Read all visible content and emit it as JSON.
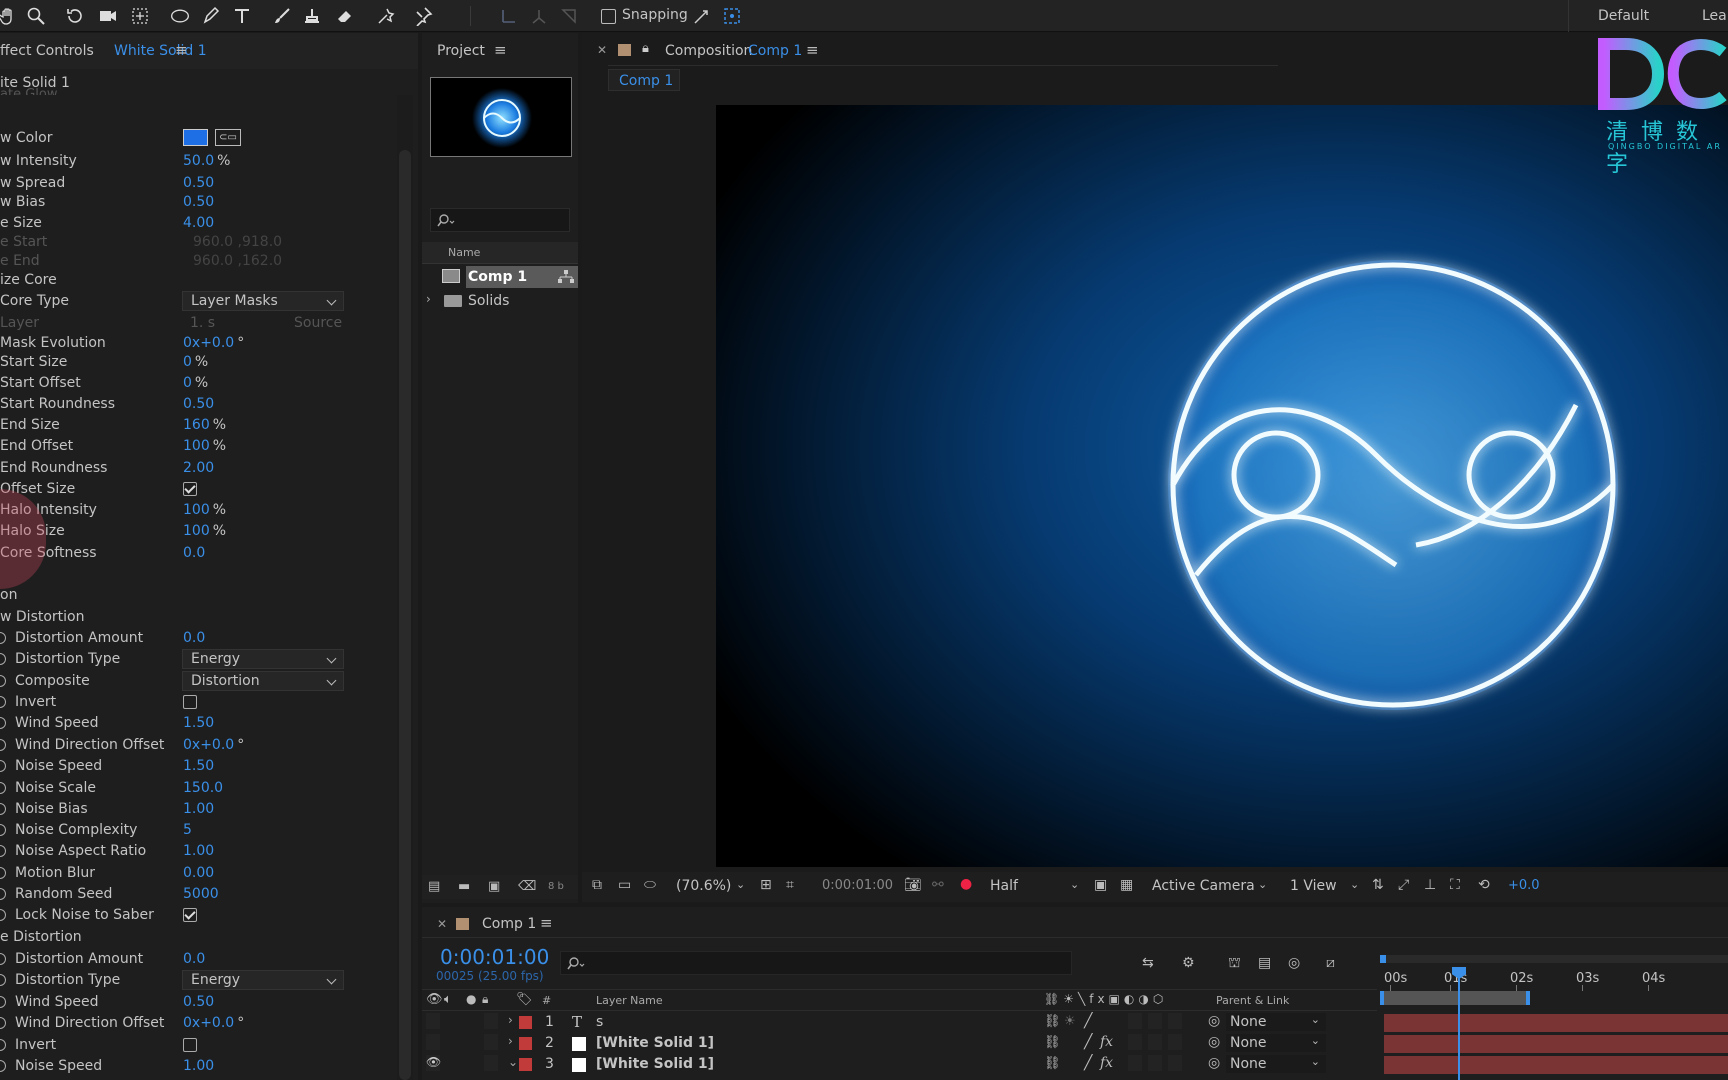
{
  "toolbar": {
    "snapping_label": "Snapping",
    "workspace_default": "Default",
    "workspace_learn": "Lear",
    "tools": [
      "hand-icon",
      "zoom-icon",
      "rotate-icon",
      "camera-icon",
      "pan-behind-icon",
      "ellipse-icon",
      "pen-icon",
      "type-icon",
      "brush-icon",
      "clone-stamp-icon",
      "eraser-icon",
      "roto-brush-icon",
      "puppet-pin-icon"
    ]
  },
  "effect_controls": {
    "tab_prefix": "ffect Controls",
    "tab_layer": "White Solid 1",
    "layer_title": "ite Solid 1",
    "partial_top": "ate Glow",
    "rows": [
      {
        "label": "w Color",
        "type": "color",
        "color": "#1e6fe6"
      },
      {
        "label": "w Intensity",
        "value": "50.0",
        "unit": "%"
      },
      {
        "label": "w Spread",
        "value": "0.50"
      },
      {
        "label": "w Bias",
        "value": "0.50"
      },
      {
        "label": "e Size",
        "value": "4.00"
      },
      {
        "label": "e Start",
        "value": "960.0 ,918.0",
        "disabled": true
      },
      {
        "label": "e End",
        "value": "960.0 ,162.0",
        "disabled": true
      },
      {
        "label": "ize Core",
        "type": "section"
      },
      {
        "label": "Core Type",
        "type": "dropdown",
        "value": "Layer Masks"
      },
      {
        "label": " Layer",
        "type": "dual-dropdown",
        "value": "1. s",
        "value2": "Source",
        "disabled": true
      },
      {
        "label": "Mask Evolution",
        "value": "0x+0.0",
        "unit": "°"
      },
      {
        "label": "Start Size",
        "value": "0",
        "unit": "%"
      },
      {
        "label": "Start Offset",
        "value": "0",
        "unit": "%"
      },
      {
        "label": "Start Roundness",
        "value": "0.50"
      },
      {
        "label": "End Size",
        "value": "160",
        "unit": "%"
      },
      {
        "label": "End Offset",
        "value": "100",
        "unit": "%"
      },
      {
        "label": "End Roundness",
        "value": "2.00"
      },
      {
        "label": "Offset Size",
        "type": "checkbox",
        "checked": true
      },
      {
        "label": "Halo Intensity",
        "value": "100",
        "unit": "%"
      },
      {
        "label": "Halo Size",
        "value": "100",
        "unit": "%"
      },
      {
        "label": "Core Softness",
        "value": "0.0"
      },
      {
        "label": "",
        "type": "blank"
      },
      {
        "label": "on",
        "type": "section"
      },
      {
        "label": "w Distortion",
        "type": "section"
      },
      {
        "label": "Distortion Amount",
        "value": "0.0",
        "sw": true
      },
      {
        "label": "Distortion Type",
        "type": "dropdown",
        "value": "Energy",
        "sw": true
      },
      {
        "label": "Composite",
        "type": "dropdown",
        "value": "Distortion",
        "sw": true
      },
      {
        "label": "Invert",
        "type": "checkbox",
        "checked": false,
        "sw": true
      },
      {
        "label": "Wind Speed",
        "value": "1.50",
        "sw": true
      },
      {
        "label": "Wind Direction Offset",
        "value": "0x+0.0",
        "unit": "°",
        "sw": true
      },
      {
        "label": "Noise Speed",
        "value": "1.50",
        "sw": true
      },
      {
        "label": "Noise Scale",
        "value": "150.0",
        "sw": true
      },
      {
        "label": "Noise Bias",
        "value": "1.00",
        "sw": true
      },
      {
        "label": "Noise Complexity",
        "value": "5",
        "sw": true
      },
      {
        "label": "Noise Aspect Ratio",
        "value": "1.00",
        "sw": true
      },
      {
        "label": "Motion Blur",
        "value": "0.00",
        "sw": true
      },
      {
        "label": "Random Seed",
        "value": "5000",
        "sw": true
      },
      {
        "label": "Lock Noise to Saber",
        "type": "checkbox",
        "checked": true,
        "sw": true
      },
      {
        "label": "e Distortion",
        "type": "section"
      },
      {
        "label": "Distortion Amount",
        "value": "0.0",
        "sw": true
      },
      {
        "label": "Distortion Type",
        "type": "dropdown",
        "value": "Energy",
        "sw": true
      },
      {
        "label": "Wind Speed",
        "value": "0.50",
        "sw": true
      },
      {
        "label": "Wind Direction Offset",
        "value": "0x+0.0",
        "unit": "°",
        "sw": true
      },
      {
        "label": "Invert",
        "type": "checkbox",
        "checked": false,
        "sw": true
      },
      {
        "label": "Noise Speed",
        "value": "1.00",
        "sw": true
      },
      {
        "label": "Noise Scale",
        "value": "100.0",
        "sw": true
      }
    ]
  },
  "project": {
    "tab_label": "Project",
    "column_name": "Name",
    "items": [
      {
        "name": "Comp 1",
        "kind": "comp",
        "selected": true
      },
      {
        "name": "Solids",
        "kind": "folder"
      }
    ],
    "bpc": "8 b"
  },
  "composition": {
    "tab_prefix": "Composition",
    "tab_comp": "Comp 1",
    "subtab": "Comp 1",
    "watermark_cn": "清 博 数 字",
    "watermark_en": "QINGBO DIGITAL AR",
    "viewer_bar": {
      "zoom": "(70.6%)",
      "timecode": "0:00:01:00",
      "resolution": "Half",
      "camera": "Active Camera",
      "views": "1 View",
      "exposure": "+0.0"
    }
  },
  "timeline": {
    "tab_label": "Comp 1",
    "timecode": "0:00:01:00",
    "frame_info": "00025 (25.00 fps)",
    "col_num": "#",
    "col_layer": "Layer Name",
    "col_parent": "Parent & Link",
    "ruler": [
      "00s",
      "01s",
      "02s",
      "03s",
      "04s"
    ],
    "layers": [
      {
        "num": "1",
        "name": "s",
        "kind": "text",
        "parent": "None",
        "visible": false
      },
      {
        "num": "2",
        "name": "[White Solid 1]",
        "kind": "solid",
        "parent": "None",
        "visible": false,
        "fx": true
      },
      {
        "num": "3",
        "name": "[White Solid 1]",
        "kind": "solid",
        "parent": "None",
        "visible": true,
        "fx": true
      }
    ]
  },
  "colors": {
    "accent": "#3a8fe8",
    "label_red": "#c23b3b",
    "track_red": "#7a3434",
    "glow": "#4fc3ff"
  }
}
